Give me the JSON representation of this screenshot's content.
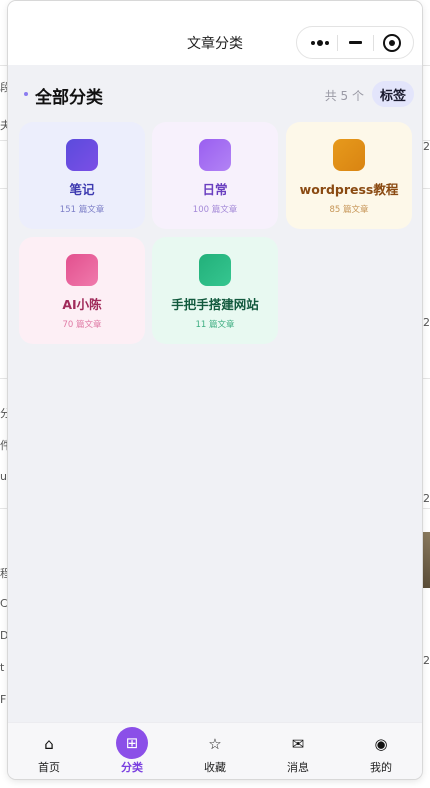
{
  "app": {
    "title": "文章分类",
    "capsule": {
      "more_icon": "more-dots-icon",
      "minimize_icon": "minimize-icon",
      "close_icon": "target-close-icon"
    }
  },
  "section": {
    "title": "全部分类",
    "count_label": "共 5 个",
    "tag_button": "标签"
  },
  "categories": [
    {
      "name": "笔记",
      "count": "151 篇文章",
      "bg": "#eceefc",
      "icon_from": "#5b4bdc",
      "icon_to": "#7b4fe6",
      "name_color": "#3d3ab0",
      "count_color": "#7e80c8"
    },
    {
      "name": "日常",
      "count": "100 篇文章",
      "bg": "#f7f1fc",
      "icon_from": "#9a5ff0",
      "icon_to": "#b283f5",
      "name_color": "#6a3fc0",
      "count_color": "#a58ad8"
    },
    {
      "name": "wordpress教程",
      "count": "85 篇文章",
      "bg": "#fdf8e9",
      "icon_from": "#e79a1c",
      "icon_to": "#d98412",
      "name_color": "#8a4a12",
      "count_color": "#c69556"
    },
    {
      "name": "AI小陈",
      "count": "70 篇文章",
      "bg": "#fdeff5",
      "icon_from": "#e2508e",
      "icon_to": "#f07aac",
      "name_color": "#a02a5a",
      "count_color": "#e07aa5"
    },
    {
      "name": "手把手搭建网站",
      "count": "11 篇文章",
      "bg": "#e8f9f1",
      "icon_from": "#22b07a",
      "icon_to": "#36c690",
      "name_color": "#125a3e",
      "count_color": "#3fae83"
    }
  ],
  "tabs": [
    {
      "label": "首页",
      "glyph": "⌂",
      "icon": "home-icon",
      "active": false
    },
    {
      "label": "分类",
      "glyph": "⊞",
      "icon": "grid-icon",
      "active": true
    },
    {
      "label": "收藏",
      "glyph": "☆",
      "icon": "star-icon",
      "active": false
    },
    {
      "label": "消息",
      "glyph": "✉",
      "icon": "mail-icon",
      "active": false
    },
    {
      "label": "我的",
      "glyph": "◉",
      "icon": "user-icon",
      "active": false
    }
  ],
  "colors": {
    "accent": "#8b4fe8",
    "page_bg": "#f0f1f5"
  },
  "background": {
    "left_fragments": [
      "段",
      "夫",
      "分",
      "件",
      "u",
      "程",
      "C",
      "D",
      "t",
      "F"
    ],
    "right_fragments": [
      "2",
      "2",
      "2",
      "2"
    ]
  }
}
